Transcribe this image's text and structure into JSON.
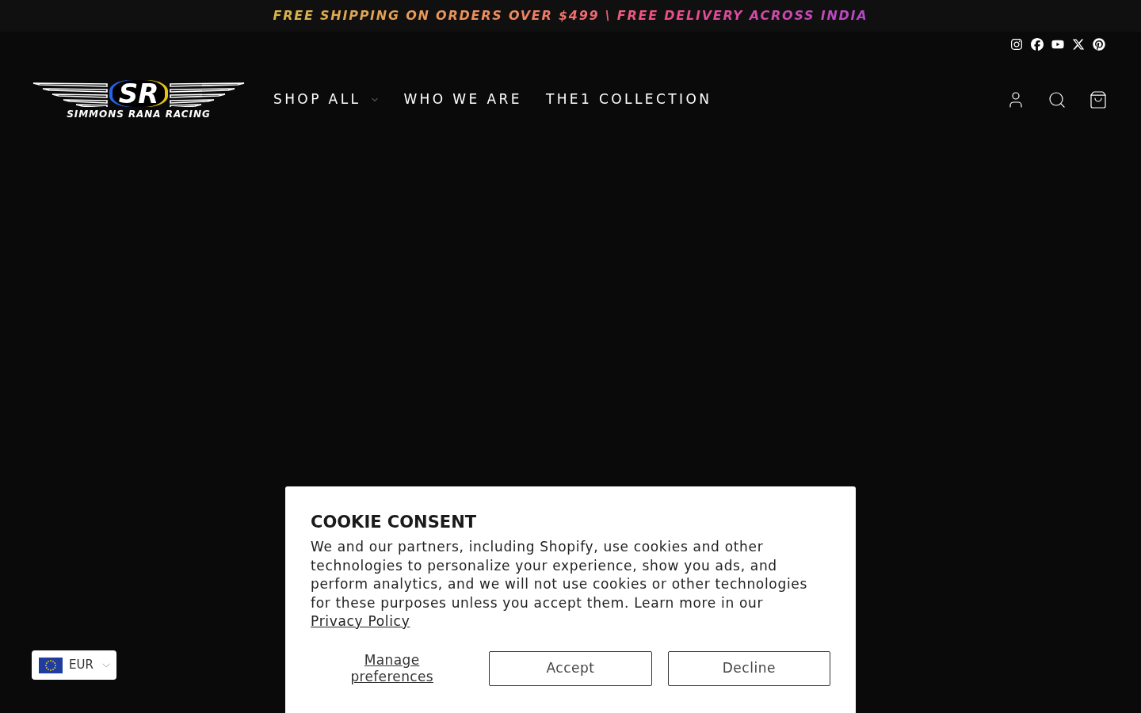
{
  "announcement": {
    "text": "FREE SHIPPING ON ORDERS OVER $499 \\ FREE DELIVERY ACROSS INDIA"
  },
  "logo": {
    "monogram": "SR",
    "wordmark": "SIMMONS RANA RACING"
  },
  "nav": [
    {
      "label": "SHOP ALL",
      "has_menu": true
    },
    {
      "label": "WHO WE ARE",
      "has_menu": false
    },
    {
      "label": "THE1 COLLECTION",
      "has_menu": false
    }
  ],
  "cookie_consent": {
    "title": "COOKIE CONSENT",
    "body": "We and our partners, including Shopify, use cookies and other technologies to personalize your experience, show you ads, and perform analytics, and we will not use cookies or other technologies for these purposes unless you accept them. Learn more in our",
    "link": "Privacy Policy",
    "buttons": [
      {
        "kind": "link",
        "label": "Manage preferences"
      },
      {
        "kind": "outline",
        "label": "Accept"
      },
      {
        "kind": "outline",
        "label": "Decline"
      }
    ]
  },
  "currency": {
    "code": "EUR"
  }
}
